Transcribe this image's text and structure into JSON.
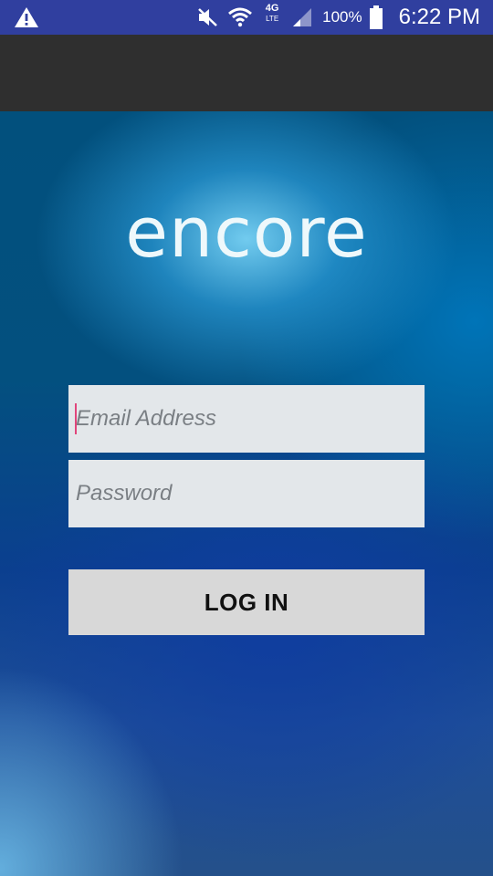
{
  "status_bar": {
    "warning_icon": "warning-triangle-icon",
    "mute_icon": "vibrate-mute-icon",
    "wifi_icon": "wifi-icon",
    "network_label": "4G",
    "network_sub": "LTE",
    "signal_icon": "cell-signal-icon",
    "battery_percent": "100%",
    "battery_icon": "battery-icon",
    "time": "6:22 PM"
  },
  "app": {
    "logo_text": "encore"
  },
  "login_form": {
    "email": {
      "value": "",
      "placeholder": "Email Address"
    },
    "password": {
      "value": "",
      "placeholder": "Password"
    },
    "login_label": "LOG IN"
  },
  "colors": {
    "status_bar": "#303f9f",
    "action_bar": "#2f2f2f",
    "input_background": "#e3e7ea",
    "button_background": "#d8d8d8",
    "cursor": "#e0457b"
  }
}
